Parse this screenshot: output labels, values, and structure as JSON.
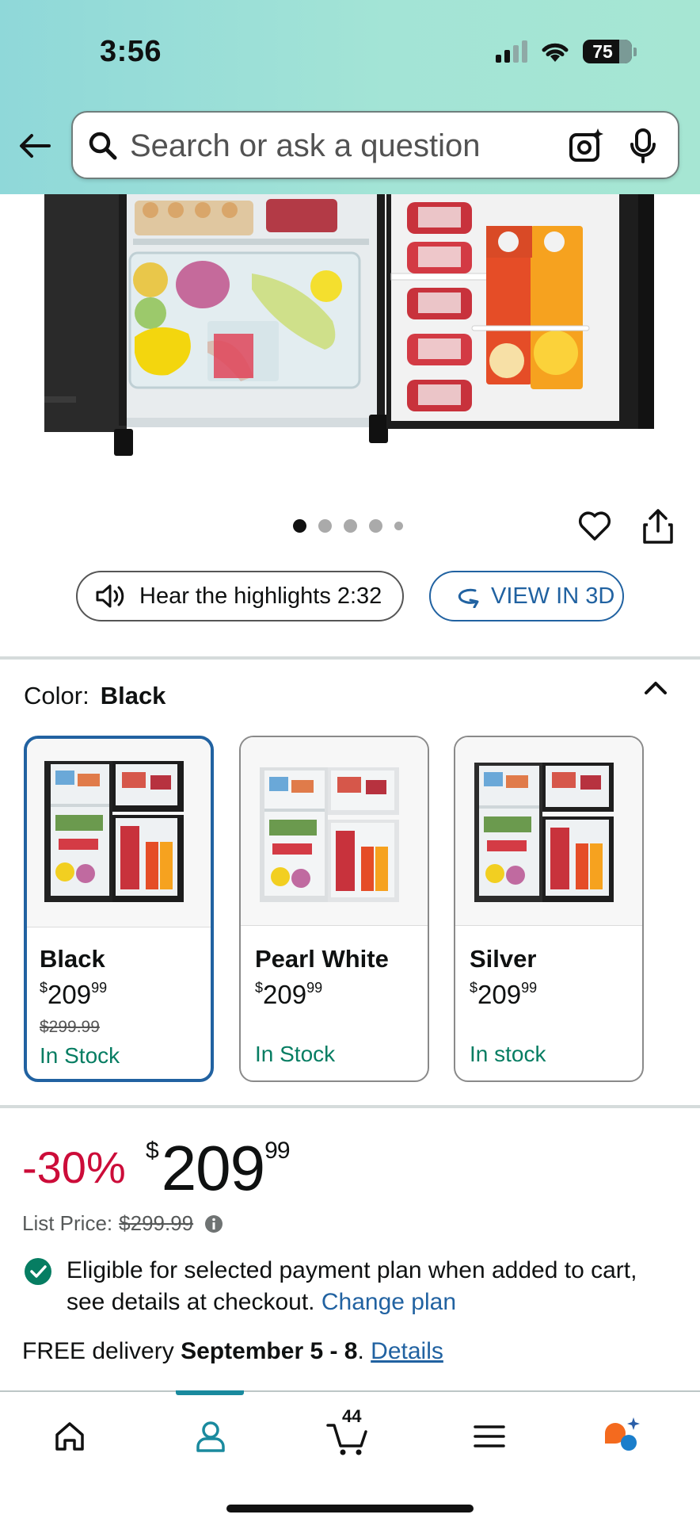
{
  "status_bar": {
    "time": "3:56",
    "battery": "75"
  },
  "search": {
    "placeholder": "Search or ask a question"
  },
  "carousel": {
    "dots": 5,
    "active_index": 0
  },
  "actions": {
    "audio_label": "Hear the highlights 2:32",
    "view3d_label": "VIEW IN 3D"
  },
  "color": {
    "label": "Color:",
    "selected": "Black",
    "options": [
      {
        "name": "Black",
        "dollars": "209",
        "cents": "99",
        "currency": "$",
        "old_price": "$299.99",
        "stock": "In Stock",
        "selected": true
      },
      {
        "name": "Pearl White",
        "dollars": "209",
        "cents": "99",
        "currency": "$",
        "old_price": "",
        "stock": "In Stock",
        "selected": false
      },
      {
        "name": "Silver",
        "dollars": "209",
        "cents": "99",
        "currency": "$",
        "old_price": "",
        "stock": "In stock",
        "selected": false
      }
    ]
  },
  "price": {
    "discount": "-30%",
    "currency": "$",
    "dollars": "209",
    "cents": "99",
    "list_label": "List Price:",
    "list_price": "$299.99"
  },
  "eligibility": {
    "text": "Eligible for selected payment plan when added to cart, see details at checkout.",
    "link": "Change plan"
  },
  "delivery": {
    "prefix": "FREE delivery",
    "dates": "September 5 - 8",
    "suffix": ".",
    "link": "Details"
  },
  "nav": {
    "cart_count": "44",
    "active": "account"
  },
  "colors": {
    "accent": "#2162a1",
    "deal": "#cc0c39",
    "stock_green": "#067d62",
    "nav_active": "#1a8a9e"
  }
}
